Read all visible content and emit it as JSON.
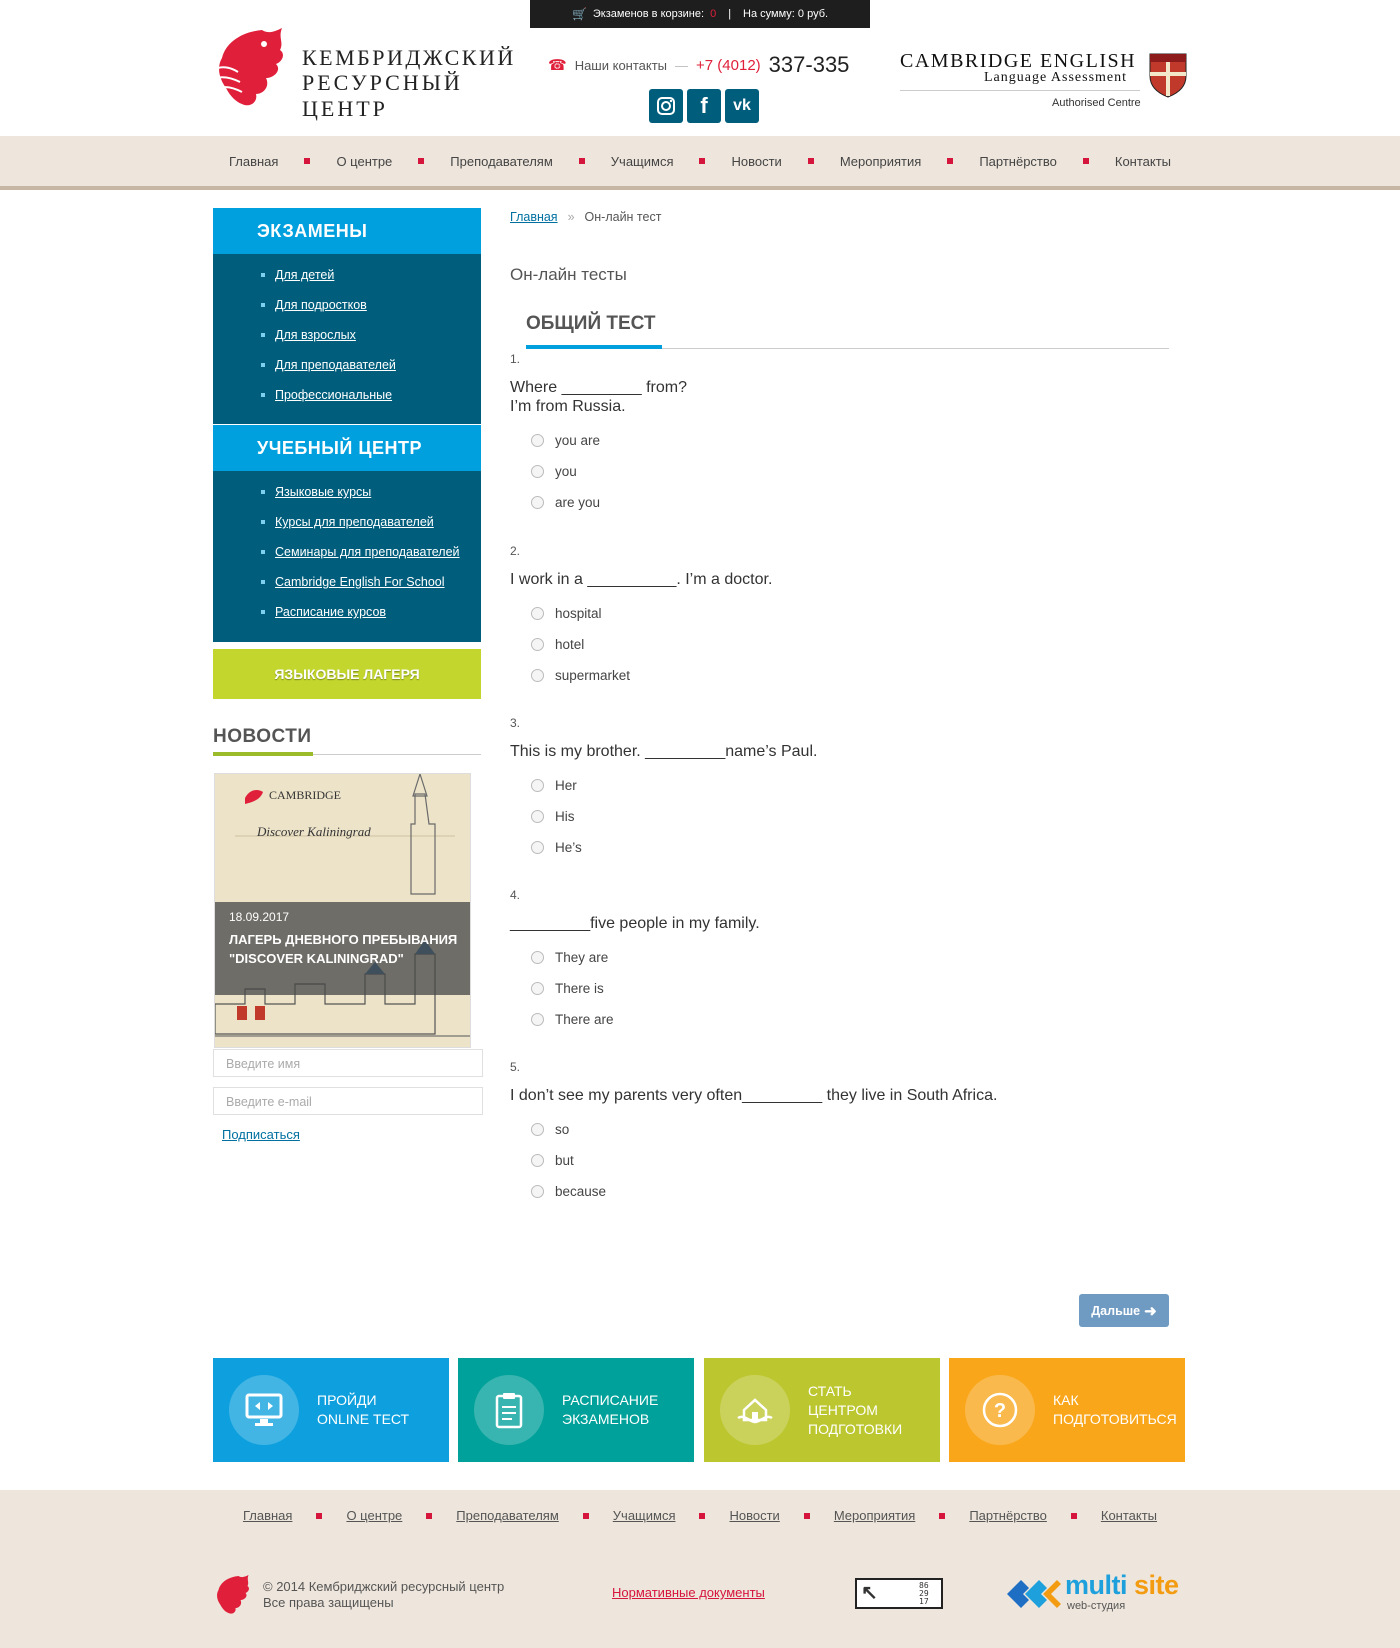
{
  "cart": {
    "label": "Экзаменов в корзине:",
    "count": "0",
    "sep": "|",
    "sum": "На сумму: 0 руб."
  },
  "logo": {
    "line1": "КЕМБРИДЖСКИЙ",
    "line2": "РЕСУРСНЫЙ  ЦЕНТР"
  },
  "contacts": {
    "label": "Наши контакты",
    "dash": "—",
    "code": "+7 (4012)",
    "number": "337-335"
  },
  "social": [
    "instagram-icon",
    "facebook-icon",
    "vk-icon"
  ],
  "cambridge": {
    "line1": "CAMBRIDGE ENGLISH",
    "line2": "Language Assessment",
    "line3": "Authorised Centre"
  },
  "nav": [
    "Главная",
    "О центре",
    "Преподавателям",
    "Учащимся",
    "Новости",
    "Мероприятия",
    "Партнёрство",
    "Контакты"
  ],
  "sidebar": {
    "exams_title": "ЭКЗАМЕНЫ",
    "exams": [
      "Для детей",
      "Для подростков",
      "Для взрослых",
      "Для преподавателей",
      "Профессиональные"
    ],
    "center_title": "УЧЕБНЫЙ ЦЕНТР",
    "center": [
      "Языковые курсы",
      "Курсы для преподавателей",
      "Семинары для преподавателей",
      "Cambridge English For School",
      "Расписание курсов"
    ],
    "camps": "ЯЗЫКОВЫЕ ЛАГЕРЯ",
    "news_title": "НОВОСТИ",
    "news_poster_brand": "CAMBRIDGE",
    "news_poster_title": "Discover Kaliningrad",
    "news_date": "18.09.2017",
    "news_headline": "ЛАГЕРЬ ДНЕВНОГО ПРЕБЫВАНИЯ \"DISCOVER KALININGRAD\"",
    "name_placeholder": "Введите имя",
    "email_placeholder": "Введите e-mail",
    "subscribe": "Подписаться"
  },
  "breadcrumb": {
    "home": "Главная",
    "sep": "»",
    "current": "Он-лайн тест"
  },
  "page_title": "Он-лайн тесты",
  "tab": "ОБЩИЙ ТЕСТ",
  "questions": [
    {
      "num": "1.",
      "text": "Where _________ from?",
      "text2": "I’m from Russia.",
      "options": [
        "you are",
        "you",
        "are you"
      ]
    },
    {
      "num": "2.",
      "text": "I work in a __________. I’m a doctor.",
      "text2": "",
      "options": [
        "hospital",
        "hotel",
        "supermarket"
      ]
    },
    {
      "num": "3.",
      "text": "This is my brother. _________name’s Paul.",
      "text2": "",
      "options": [
        "Her",
        "His",
        "He’s"
      ]
    },
    {
      "num": "4.",
      "text": "_________five people in my family.",
      "text2": "",
      "options": [
        "They are",
        "There is",
        "There are"
      ]
    },
    {
      "num": "5.",
      "text": "I don’t see my parents very often_________ they live in South Africa.",
      "text2": "",
      "options": [
        "so",
        "but",
        "because"
      ]
    }
  ],
  "next_button": "Дальше",
  "tiles": [
    {
      "line1": "ПРОЙДИ",
      "line2": "ONLINE ТЕСТ",
      "line3": "",
      "color": "#0ea0de",
      "icon": "monitor-icon"
    },
    {
      "line1": "РАСПИСАНИЕ",
      "line2": "ЭКЗАМЕНОВ",
      "line3": "",
      "color": "#00a19a",
      "icon": "clipboard-icon"
    },
    {
      "line1": "СТАТЬ",
      "line2": "ЦЕНТРОМ",
      "line3": "ПОДГОТОВКИ",
      "color": "#bcc62f",
      "icon": "hands-house-icon"
    },
    {
      "line1": "КАК",
      "line2": "ПОДГОТОВИТЬСЯ",
      "line3": "",
      "color": "#f9a61a",
      "icon": "question-icon"
    }
  ],
  "footer": {
    "nav": [
      "Главная",
      "О центре",
      "Преподавателям",
      "Учащимся",
      "Новости",
      "Мероприятия",
      "Партнёрство",
      "Контакты"
    ],
    "copy1": "© 2014 Кембриджский ресурсный центр",
    "copy2": "Все права защищены",
    "docs": "Нормативные документы",
    "counter": "86 29 17",
    "studio1": "multi",
    "studio2": "site",
    "studio_sub": "web-студия"
  }
}
